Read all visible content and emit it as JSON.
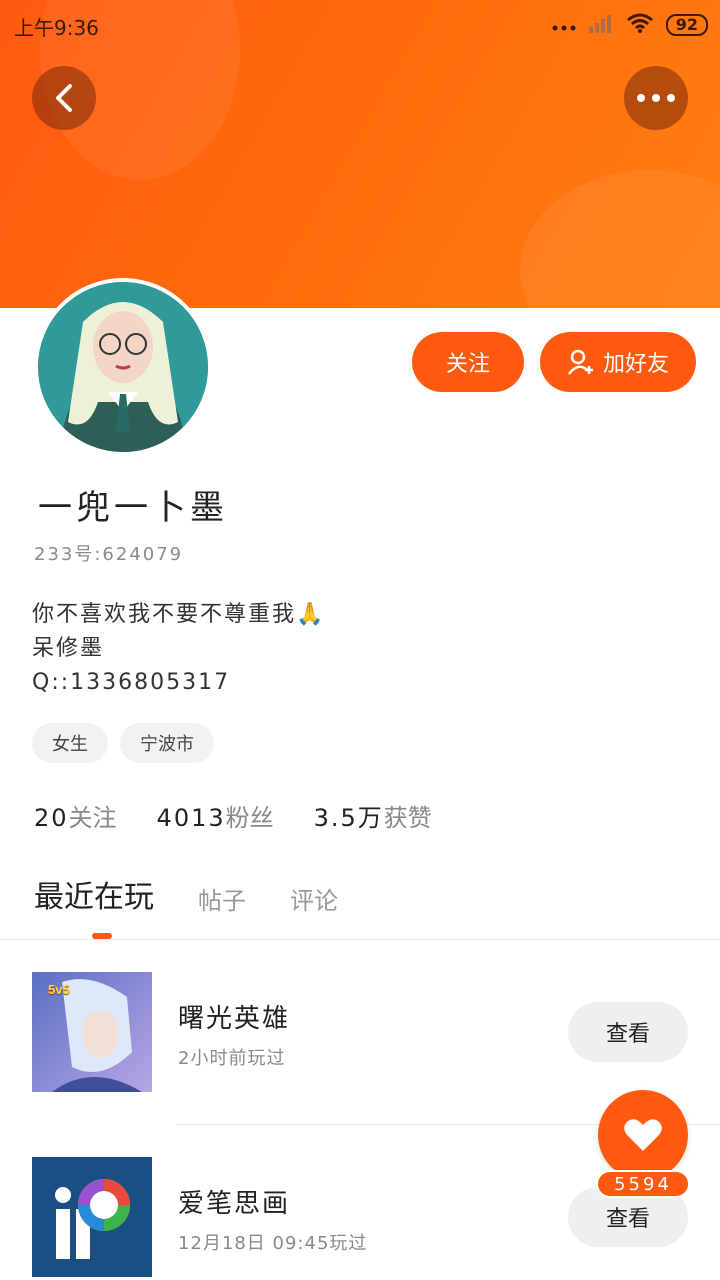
{
  "status_bar": {
    "time": "上午9:36",
    "battery": "92"
  },
  "profile": {
    "name": "一兜一卜墨",
    "uid": "233号:624079",
    "bio_line1": "你不喜欢我不要不尊重我🙏",
    "bio_line2": "呆修墨",
    "bio_line3": "Q::1336805317",
    "tags": [
      "女生",
      "宁波市"
    ]
  },
  "actions": {
    "follow": "关注",
    "add_friend": "加好友"
  },
  "stats": [
    {
      "value": "20",
      "label": "关注"
    },
    {
      "value": "4013",
      "label": "粉丝"
    },
    {
      "value": "3.5万",
      "label": "获赞"
    }
  ],
  "tabs": [
    "最近在玩",
    "帖子",
    "评论"
  ],
  "games": [
    {
      "title": "曙光英雄",
      "subtitle": "2小时前玩过",
      "button": "查看",
      "thumb_badge": "5v5"
    },
    {
      "title": "爱笔思画",
      "subtitle": "12月18日 09:45玩过",
      "button": "查看"
    }
  ],
  "like": {
    "count": "5594"
  },
  "colors": {
    "accent": "#ff5a10",
    "header_gradient_end": "#ff7e14"
  }
}
